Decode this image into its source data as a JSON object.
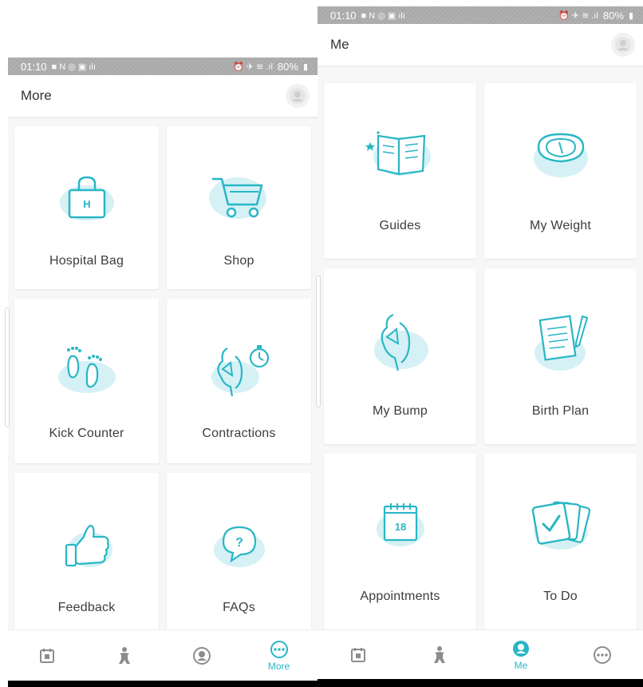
{
  "colors": {
    "accent": "#29b6c5",
    "icon_blob": "#d5f1f5",
    "muted_icon": "#8c8c8c"
  },
  "left_screen": {
    "status": {
      "time": "01:10",
      "battery": "80%"
    },
    "title": "More",
    "cards": [
      {
        "label": "Hospital Bag",
        "icon": "hospital-bag-icon"
      },
      {
        "label": "Shop",
        "icon": "shopping-cart-icon"
      },
      {
        "label": "Kick Counter",
        "icon": "baby-feet-icon"
      },
      {
        "label": "Contractions",
        "icon": "contractions-timer-icon"
      },
      {
        "label": "Feedback",
        "icon": "thumbs-up-icon"
      },
      {
        "label": "FAQs",
        "icon": "question-bubble-icon"
      }
    ],
    "nav": [
      {
        "label": "",
        "icon": "calendar-icon"
      },
      {
        "label": "",
        "icon": "baby-icon"
      },
      {
        "label": "",
        "icon": "profile-icon"
      },
      {
        "label": "More",
        "icon": "more-icon",
        "active": true
      }
    ]
  },
  "right_screen": {
    "status": {
      "time": "01:10",
      "battery": "80%"
    },
    "title": "Me",
    "cards": [
      {
        "label": "Guides",
        "icon": "open-book-icon"
      },
      {
        "label": "My Weight",
        "icon": "scale-icon"
      },
      {
        "label": "My Bump",
        "icon": "pregnant-bump-icon"
      },
      {
        "label": "Birth Plan",
        "icon": "document-pen-icon"
      },
      {
        "label": "Appointments",
        "icon": "calendar-date-icon",
        "calendar_day": "18"
      },
      {
        "label": "To Do",
        "icon": "checklist-cards-icon"
      }
    ],
    "nav": [
      {
        "label": "",
        "icon": "calendar-icon"
      },
      {
        "label": "",
        "icon": "baby-icon"
      },
      {
        "label": "Me",
        "icon": "profile-icon",
        "active": true
      },
      {
        "label": "",
        "icon": "more-icon"
      }
    ]
  }
}
